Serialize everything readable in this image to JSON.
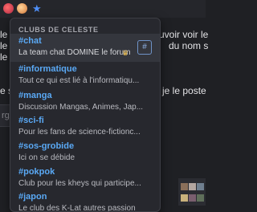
{
  "background": {
    "line1_right": "uvoir voir le",
    "line2_right": "du nom s",
    "line3_left": "le",
    "line4_left": "le",
    "line5_left": "le",
    "line6_right": "je le poste",
    "line7_left": "e s",
    "input_fragment": "rg/"
  },
  "dropdown": {
    "header": "CLUBS DE CELESTE",
    "items": [
      {
        "name": "#chat",
        "desc": "La team chat DOMINE le forum",
        "badge_icon": "crown-icon",
        "action_icon": "#"
      },
      {
        "name": "#informatique",
        "desc": "Tout ce qui est lié à l'informatiqu..."
      },
      {
        "name": "#manga",
        "desc": "Discussion Mangas, Animes, Jap..."
      },
      {
        "name": "#sci-fi",
        "desc": "Pour les fans de science-fictionc..."
      },
      {
        "name": "#sos-grobide",
        "desc": "Ici on se débide"
      },
      {
        "name": "#pokpok",
        "desc": "Club pour les kheys qui participe..."
      },
      {
        "name": "#japon",
        "desc": "Le club des K-Lat autres passion"
      }
    ]
  },
  "colors": {
    "accent": "#5aa9f5",
    "background": "#1f2024",
    "dropdown_bg": "#27282e",
    "active_row": "#34363d"
  }
}
